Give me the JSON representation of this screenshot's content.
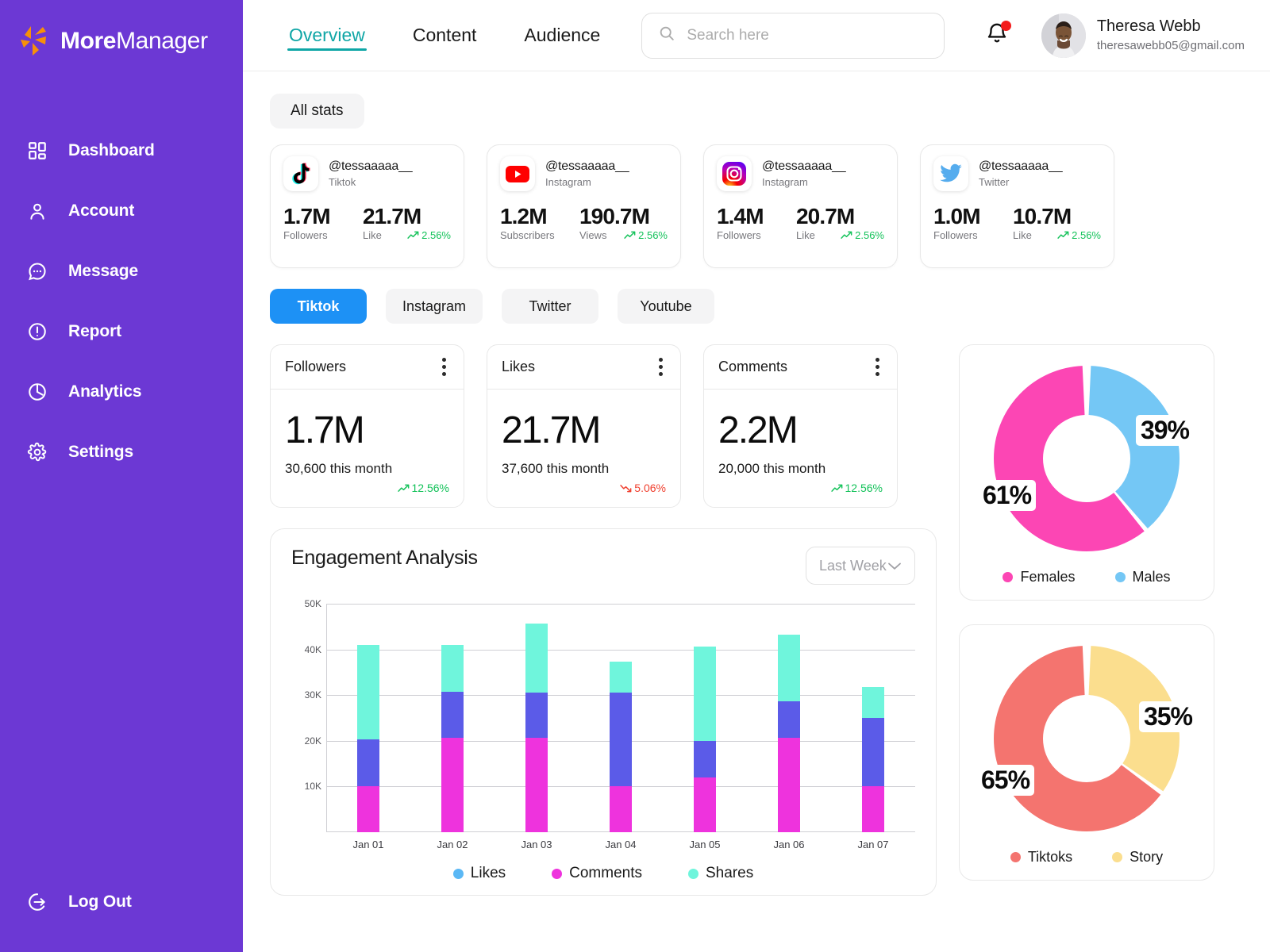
{
  "brand": {
    "name_bold": "More",
    "name_light": "Manager",
    "logo_icon": "spark-logo-icon",
    "logo_color": "#F79009"
  },
  "sidebar": {
    "items": [
      {
        "label": "Dashboard",
        "icon": "grid-icon"
      },
      {
        "label": "Account",
        "icon": "user-icon"
      },
      {
        "label": "Message",
        "icon": "chat-bubble-icon"
      },
      {
        "label": "Report",
        "icon": "alert-circle-icon"
      },
      {
        "label": "Analytics",
        "icon": "pie-chart-icon"
      },
      {
        "label": "Settings",
        "icon": "gear-icon"
      }
    ],
    "logout": {
      "label": "Log Out",
      "icon": "logout-icon"
    },
    "bg_color": "#6C38D4"
  },
  "header": {
    "tabs": [
      {
        "label": "Overview",
        "active": true
      },
      {
        "label": "Content",
        "active": false
      },
      {
        "label": "Audience",
        "active": false
      }
    ],
    "active_color": "#0FA6A6",
    "search": {
      "placeholder": "Search here",
      "value": "",
      "icon": "search-icon"
    },
    "notifications": {
      "icon": "bell-icon",
      "has_unread": true,
      "dot_color": "#F31B1B"
    },
    "profile": {
      "name": "Theresa Webb",
      "email": "theresawebb05@gmail.com",
      "avatar": "avatar"
    }
  },
  "toolbar": {
    "all_stats_label": "All stats"
  },
  "accounts": [
    {
      "handle": "@tessaaaaa__",
      "platform": "Tiktok",
      "icon": "tiktok-icon",
      "metrics": [
        {
          "value": "1.7M",
          "label": "Followers"
        },
        {
          "value": "21.7M",
          "label": "Like"
        }
      ],
      "delta": "2.56%",
      "delta_dir": "up"
    },
    {
      "handle": "@tessaaaaa__",
      "platform": "Instagram",
      "icon": "youtube-icon",
      "metrics": [
        {
          "value": "1.2M",
          "label": "Subscribers"
        },
        {
          "value": "190.7M",
          "label": "Views"
        }
      ],
      "delta": "2.56%",
      "delta_dir": "up"
    },
    {
      "handle": "@tessaaaaa__",
      "platform": "Instagram",
      "icon": "instagram-icon",
      "metrics": [
        {
          "value": "1.4M",
          "label": "Followers"
        },
        {
          "value": "20.7M",
          "label": "Like"
        }
      ],
      "delta": "2.56%",
      "delta_dir": "up"
    },
    {
      "handle": "@tessaaaaa__",
      "platform": "Twitter",
      "icon": "twitter-icon",
      "metrics": [
        {
          "value": "1.0M",
          "label": "Followers"
        },
        {
          "value": "10.7M",
          "label": "Like"
        }
      ],
      "delta": "2.56%",
      "delta_dir": "up"
    }
  ],
  "platform_tabs": [
    {
      "label": "Tiktok",
      "active": true
    },
    {
      "label": "Instagram",
      "active": false
    },
    {
      "label": "Twitter",
      "active": false
    },
    {
      "label": "Youtube",
      "active": false
    }
  ],
  "platform_active_color": "#1D91F5",
  "metrics": [
    {
      "title": "Followers",
      "value": "1.7M",
      "sub": "30,600 this month",
      "delta": "12.56%",
      "dir": "up"
    },
    {
      "title": "Likes",
      "value": "21.7M",
      "sub": "37,600 this month",
      "delta": "5.06%",
      "dir": "down"
    },
    {
      "title": "Comments",
      "value": "2.2M",
      "sub": "20,000 this month",
      "delta": "12.56%",
      "dir": "up"
    }
  ],
  "chart_data": [
    {
      "type": "bar",
      "title": "Engagement Analysis",
      "range_selector": {
        "value": "Last Week",
        "icon": "chevron-down-icon"
      },
      "stacked": true,
      "categories": [
        "Jan 01",
        "Jan 02",
        "Jan 03",
        "Jan 04",
        "Jan 05",
        "Jan 06",
        "Jan 07"
      ],
      "series": [
        {
          "name": "Comments",
          "color": "#EE33DD",
          "values": [
            10000,
            20600,
            20600,
            10000,
            12000,
            20600,
            10000
          ]
        },
        {
          "name": "Likes",
          "color": "#5B5BE8",
          "values": [
            10400,
            10100,
            10000,
            20500,
            8000,
            8100,
            15000
          ]
        },
        {
          "name": "Shares",
          "color": "#6FF5DC",
          "values": [
            20500,
            10200,
            15100,
            6800,
            20700,
            14600,
            6700
          ]
        }
      ],
      "totals": [
        40900,
        40900,
        45700,
        37300,
        40700,
        43300,
        31700
      ],
      "ylabel": "",
      "xlabel": "",
      "ylim": [
        0,
        50000
      ],
      "yticks": [
        "10K",
        "20K",
        "30K",
        "40K",
        "50K"
      ],
      "ytick_values": [
        10000,
        20000,
        30000,
        40000,
        50000
      ],
      "grid": true,
      "legend": [
        {
          "name": "Likes",
          "color": "#5BB8F5"
        },
        {
          "name": "Comments",
          "color": "#EE33DD"
        },
        {
          "name": "Shares",
          "color": "#6FF5DC"
        }
      ],
      "legend_position": "bottom"
    },
    {
      "type": "pie",
      "variant": "donut",
      "title": "",
      "labels": [
        "Females",
        "Males"
      ],
      "values": [
        61,
        39
      ],
      "display_values": [
        "61%",
        "39%"
      ],
      "colors": [
        "#FC46B4",
        "#74C7F5"
      ],
      "legend_position": "bottom"
    },
    {
      "type": "pie",
      "variant": "donut",
      "title": "",
      "labels": [
        "Tiktoks",
        "Story"
      ],
      "values": [
        65,
        35
      ],
      "display_values": [
        "65%",
        "35%"
      ],
      "colors": [
        "#F4746F",
        "#FBDE8E"
      ],
      "legend_position": "bottom"
    }
  ]
}
